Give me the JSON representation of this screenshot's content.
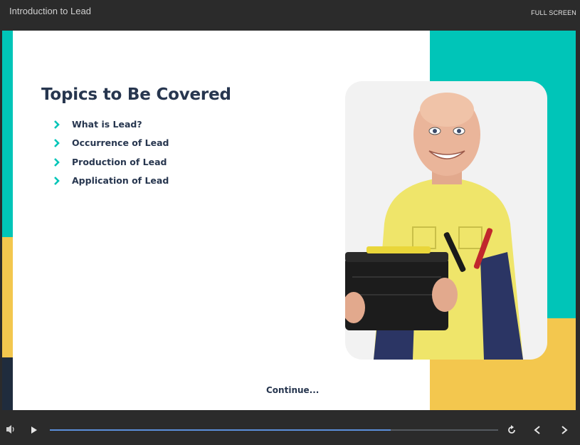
{
  "header": {
    "title": "Introduction to Lead",
    "fullscreen_label": "FULL SCREEN"
  },
  "slide": {
    "heading": "Topics to Be Covered",
    "topics": [
      "What is Lead?",
      "Occurrence of Lead",
      "Production of Lead",
      "Application of Lead"
    ],
    "continue_label": "Continue...",
    "photo_icon": "man-holding-car-battery-photo"
  },
  "player": {
    "progress_percent": 76,
    "icons": [
      "volume-icon",
      "play-icon",
      "replay-icon",
      "previous-icon",
      "next-icon"
    ]
  },
  "colors": {
    "teal": "#00c5b8",
    "yellow": "#f3c74e",
    "navy": "#27364f",
    "progress": "#5b8fdb"
  }
}
